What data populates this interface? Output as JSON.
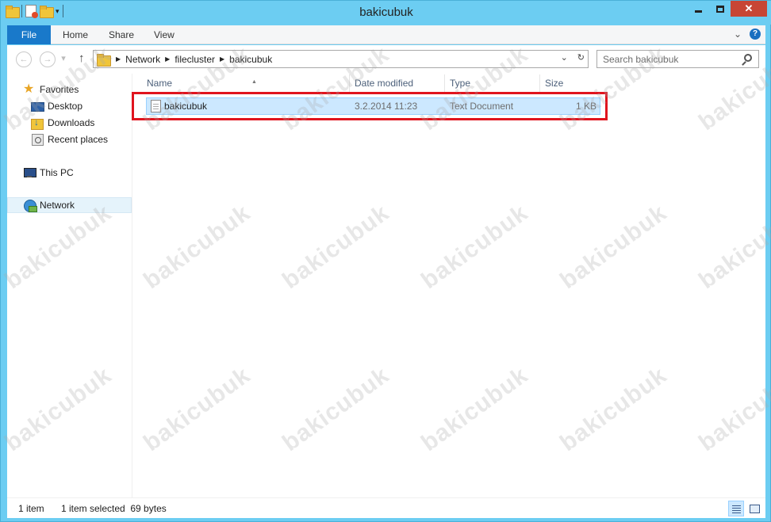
{
  "window": {
    "title": "bakicubuk"
  },
  "ribbon": {
    "tabs": [
      "File",
      "Home",
      "Share",
      "View"
    ]
  },
  "address": {
    "breadcrumbs": [
      "Network",
      "filecluster",
      "bakicubuk"
    ]
  },
  "search": {
    "placeholder": "Search bakicubuk"
  },
  "navpane": {
    "favorites": "Favorites",
    "items": [
      "Desktop",
      "Downloads",
      "Recent places"
    ],
    "this_pc": "This PC",
    "network": "Network"
  },
  "filelist": {
    "columns": [
      "Name",
      "Date modified",
      "Type",
      "Size"
    ],
    "rows": [
      {
        "name": "bakicubuk",
        "date": "3.2.2014 11:23",
        "type": "Text Document",
        "size": "1 KB"
      }
    ]
  },
  "status": {
    "count": "1 item",
    "selection": "1 item selected  69 bytes"
  },
  "watermark": {
    "text": "bakicubuk"
  },
  "colors": {
    "accent": "#1979ca",
    "highlight": "#e0141e",
    "selection": "#cce8ff",
    "frame": "#6ccdf2"
  }
}
